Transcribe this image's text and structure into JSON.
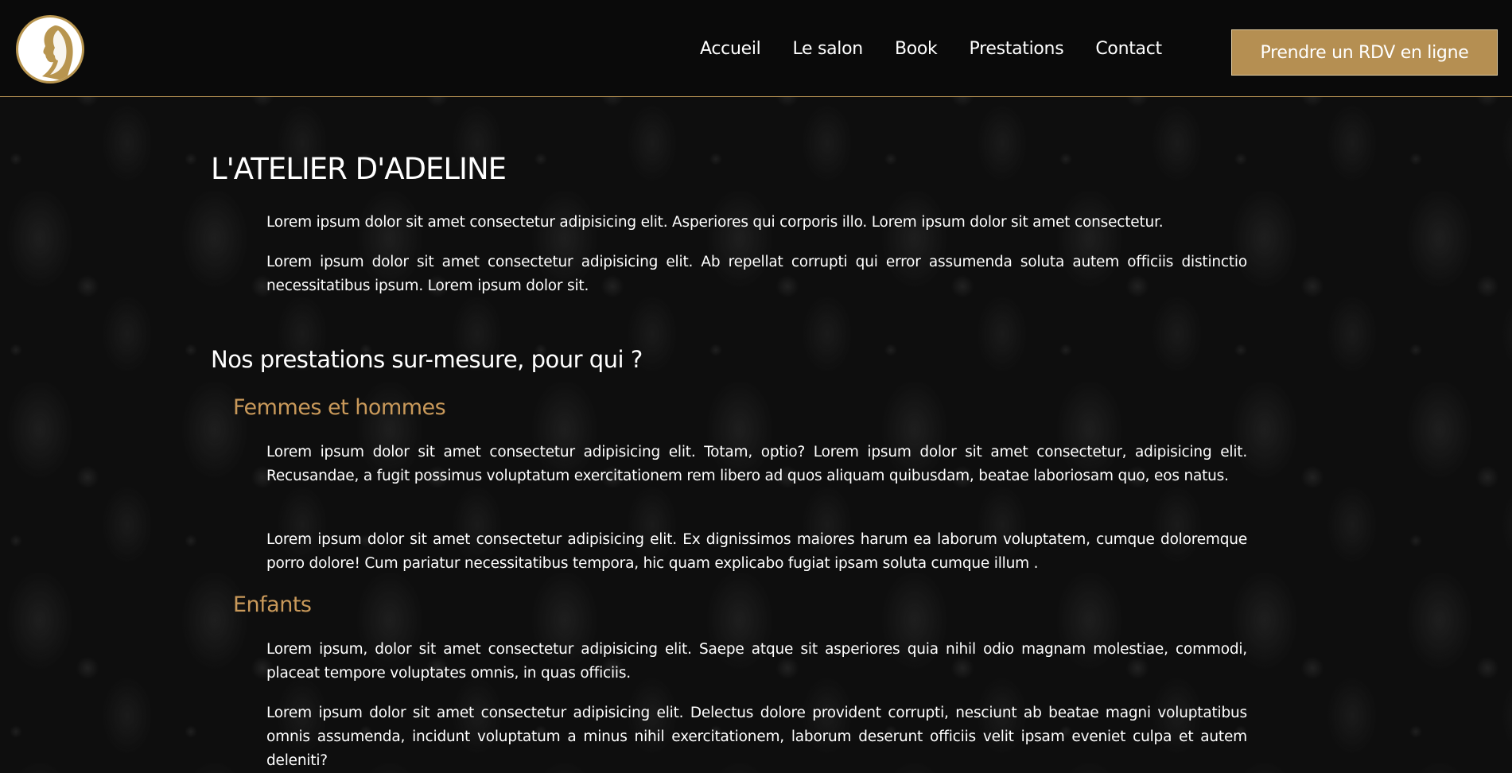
{
  "header": {
    "logo_icon": "woman-profile-icon",
    "nav": [
      "Accueil",
      "Le salon",
      "Book",
      "Prestations",
      "Contact"
    ],
    "cta_label": "Prendre un RDV en ligne",
    "accent_color": "#b58f52"
  },
  "main": {
    "title": "L'ATELIER D'ADELINE",
    "intro": [
      "Lorem ipsum dolor sit amet consectetur adipisicing elit. Asperiores qui corporis illo. Lorem ipsum dolor sit amet consectetur.",
      "Lorem ipsum dolor sit amet consectetur adipisicing elit. Ab repellat corrupti qui error assumenda soluta autem officiis distinctio necessitatibus ipsum. Lorem ipsum dolor sit."
    ],
    "section_title": "Nos prestations sur-mesure, pour qui ?",
    "groups": [
      {
        "title": "Femmes et hommes",
        "paragraphs": [
          "Lorem ipsum dolor sit amet consectetur adipisicing elit. Totam, optio? Lorem ipsum dolor sit amet consectetur, adipisicing elit. Recusandae, a fugit possimus voluptatum exercitationem rem libero ad quos aliquam quibusdam, beatae laboriosam quo, eos natus.",
          "Lorem ipsum dolor sit amet consectetur adipisicing elit. Ex dignissimos maiores harum ea laborum voluptatem, cumque doloremque porro dolore! Cum pariatur necessitatibus tempora, hic quam explicabo fugiat ipsam soluta cumque illum ."
        ]
      },
      {
        "title": "Enfants",
        "paragraphs": [
          "Lorem ipsum, dolor sit amet consectetur adipisicing elit. Saepe atque sit asperiores quia nihil odio magnam molestiae, commodi, placeat tempore voluptates omnis, in quas officiis.",
          "Lorem ipsum dolor sit amet consectetur adipisicing elit. Delectus dolore provident corrupti, nesciunt ab beatae magni voluptatibus omnis assumenda, incidunt voluptatum a minus nihil exercitationem, laborum deserunt officiis velit ipsam eveniet culpa et autem deleniti?"
        ]
      }
    ]
  }
}
